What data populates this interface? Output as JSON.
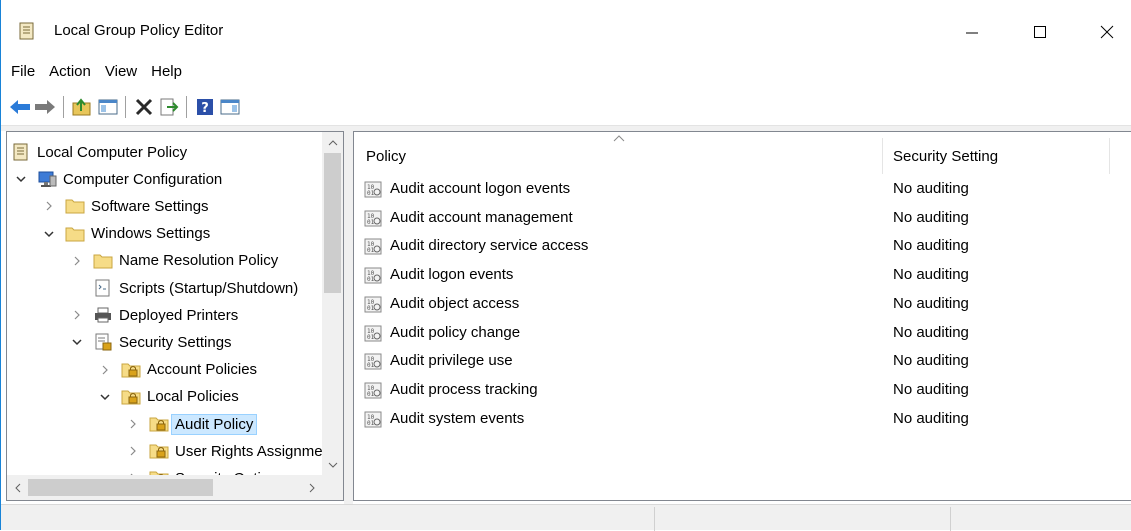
{
  "window": {
    "title": "Local Group Policy Editor"
  },
  "menu": [
    "File",
    "Action",
    "View",
    "Help"
  ],
  "tree": [
    {
      "label": "Local Computer Policy",
      "level": 0,
      "expander": "none",
      "icon": "policy-doc-icon"
    },
    {
      "label": "Computer Configuration",
      "level": 0,
      "expander": "expanded",
      "icon": "computer-icon"
    },
    {
      "label": "Software Settings",
      "level": 1,
      "expander": "collapsed",
      "icon": "folder-icon"
    },
    {
      "label": "Windows Settings",
      "level": 1,
      "expander": "expanded",
      "icon": "folder-icon"
    },
    {
      "label": "Name Resolution Policy",
      "level": 2,
      "expander": "collapsed",
      "icon": "folder-icon"
    },
    {
      "label": "Scripts (Startup/Shutdown)",
      "level": 2,
      "expander": "none",
      "icon": "script-icon"
    },
    {
      "label": "Deployed Printers",
      "level": 2,
      "expander": "collapsed",
      "icon": "printer-icon"
    },
    {
      "label": "Security Settings",
      "level": 2,
      "expander": "expanded",
      "icon": "security-settings-icon"
    },
    {
      "label": "Account Policies",
      "level": 3,
      "expander": "collapsed",
      "icon": "secure-folder-icon"
    },
    {
      "label": "Local Policies",
      "level": 3,
      "expander": "expanded",
      "icon": "secure-folder-icon"
    },
    {
      "label": "Audit Policy",
      "level": 4,
      "expander": "collapsed",
      "icon": "secure-folder-icon",
      "selected": true
    },
    {
      "label": "User Rights Assignment",
      "level": 4,
      "expander": "collapsed",
      "icon": "secure-folder-icon"
    },
    {
      "label": "Security Options",
      "level": 4,
      "expander": "collapsed",
      "icon": "secure-folder-icon"
    }
  ],
  "list": {
    "columns": [
      "Policy",
      "Security Setting"
    ],
    "rows": [
      {
        "policy": "Audit account logon events",
        "setting": "No auditing"
      },
      {
        "policy": "Audit account management",
        "setting": "No auditing"
      },
      {
        "policy": "Audit directory service access",
        "setting": "No auditing"
      },
      {
        "policy": "Audit logon events",
        "setting": "No auditing"
      },
      {
        "policy": "Audit object access",
        "setting": "No auditing"
      },
      {
        "policy": "Audit policy change",
        "setting": "No auditing"
      },
      {
        "policy": "Audit privilege use",
        "setting": "No auditing"
      },
      {
        "policy": "Audit process tracking",
        "setting": "No auditing"
      },
      {
        "policy": "Audit system events",
        "setting": "No auditing"
      }
    ]
  },
  "colors": {
    "selection_bg": "#cce8ff",
    "selection_border": "#99d1ff",
    "window_border": "#1883d7"
  }
}
